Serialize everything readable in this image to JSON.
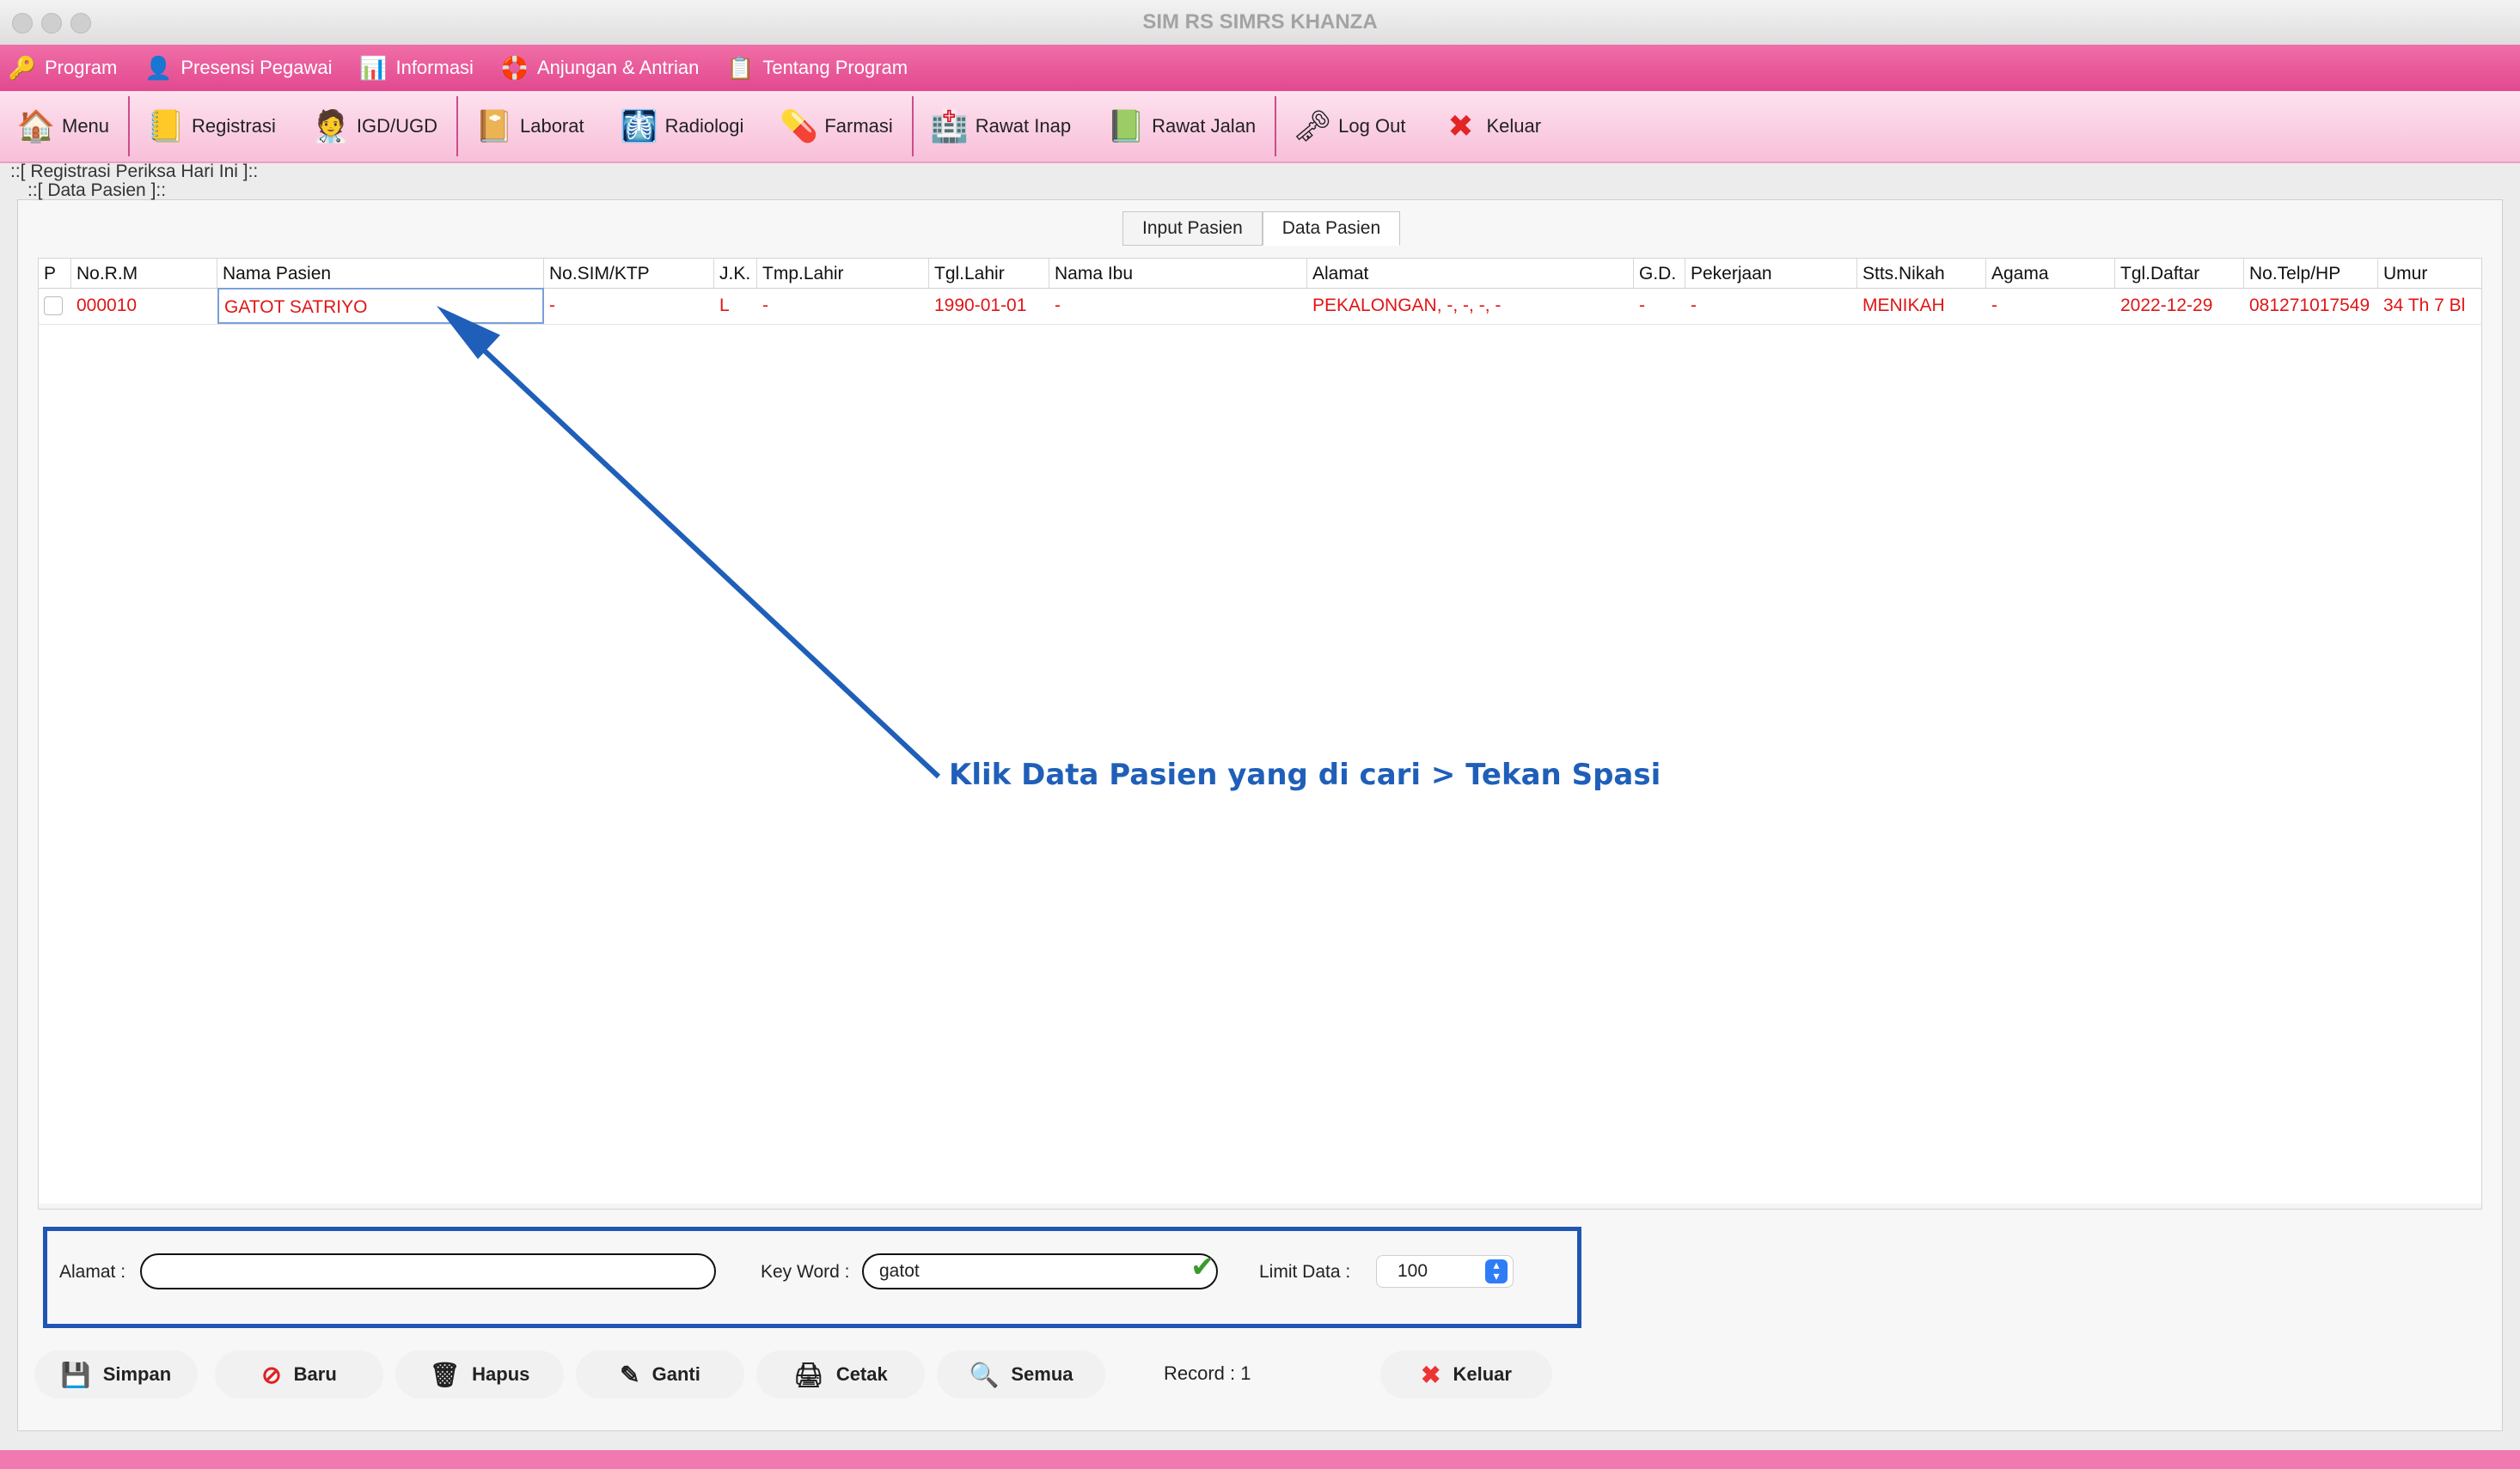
{
  "window": {
    "title": "SIM RS SIMRS KHANZA"
  },
  "menubar": {
    "items": [
      {
        "label": "Program",
        "icon": "key-icon",
        "glyph": "🔑"
      },
      {
        "label": "Presensi Pegawai",
        "icon": "person-icon",
        "glyph": "👤"
      },
      {
        "label": "Informasi",
        "icon": "chart-icon",
        "glyph": "📊"
      },
      {
        "label": "Anjungan & Antrian",
        "icon": "lifebuoy-icon",
        "glyph": "🛟"
      },
      {
        "label": "Tentang Program",
        "icon": "clipboard-icon",
        "glyph": "📋"
      }
    ]
  },
  "toolbar": {
    "items": [
      {
        "label": "Menu",
        "icon": "home-icon",
        "glyph": "🏠"
      },
      {
        "label": "Registrasi",
        "icon": "register-icon",
        "glyph": "📒"
      },
      {
        "label": "IGD/UGD",
        "icon": "doctor-icon",
        "glyph": "🧑‍⚕️"
      },
      {
        "label": "Laborat",
        "icon": "lab-book-icon",
        "glyph": "📔"
      },
      {
        "label": "Radiologi",
        "icon": "radiology-icon",
        "glyph": "🩻"
      },
      {
        "label": "Farmasi",
        "icon": "pharmacy-icon",
        "glyph": "💊"
      },
      {
        "label": "Rawat Inap",
        "icon": "inpatient-icon",
        "glyph": "🏥"
      },
      {
        "label": "Rawat Jalan",
        "icon": "outpatient-icon",
        "glyph": "📗"
      },
      {
        "label": "Log Out",
        "icon": "keys-icon",
        "glyph": "🗝"
      },
      {
        "label": "Keluar",
        "icon": "exit-x-icon",
        "glyph": "✖"
      }
    ]
  },
  "page": {
    "reg_label": "::[ Registrasi Periksa Hari Ini ]::",
    "data_label": "::[ Data Pasien ]::"
  },
  "tabs": [
    {
      "label": "Input Pasien"
    },
    {
      "label": "Data Pasien"
    }
  ],
  "table": {
    "columns": [
      "P",
      "No.R.M",
      "Nama Pasien",
      "No.SIM/KTP",
      "J.K.",
      "Tmp.Lahir",
      "Tgl.Lahir",
      "Nama Ibu",
      "Alamat",
      "G.D.",
      "Pekerjaan",
      "Stts.Nikah",
      "Agama",
      "Tgl.Daftar",
      "No.Telp/HP",
      "Umur"
    ],
    "rows": [
      [
        "",
        "000010",
        "GATOT SATRIYO",
        "-",
        "L",
        "-",
        "1990-01-01",
        "-",
        "PEKALONGAN, -, -, -, -",
        "-",
        "-",
        "MENIKAH",
        "-",
        "2022-12-29",
        "081271017549",
        "34 Th 7 Bl"
      ]
    ]
  },
  "annotation": {
    "text": "Klik Data Pasien yang di cari > Tekan Spasi",
    "color": "#1f5fb9"
  },
  "search": {
    "alamat_label": "Alamat :",
    "alamat_value": "",
    "keyword_label": "Key Word :",
    "keyword_value": "gatot",
    "limit_label": "Limit Data :",
    "limit_value": "100"
  },
  "actions": {
    "simpan": "Simpan",
    "baru": "Baru",
    "hapus": "Hapus",
    "ganti": "Ganti",
    "cetak": "Cetak",
    "semua": "Semua",
    "record": "Record :  1",
    "keluar": "Keluar"
  },
  "colors": {
    "menubar": "#e2498f",
    "toolbar": "#f8bfd9",
    "highlight": "#1f55b3",
    "row_text": "#e21515"
  }
}
